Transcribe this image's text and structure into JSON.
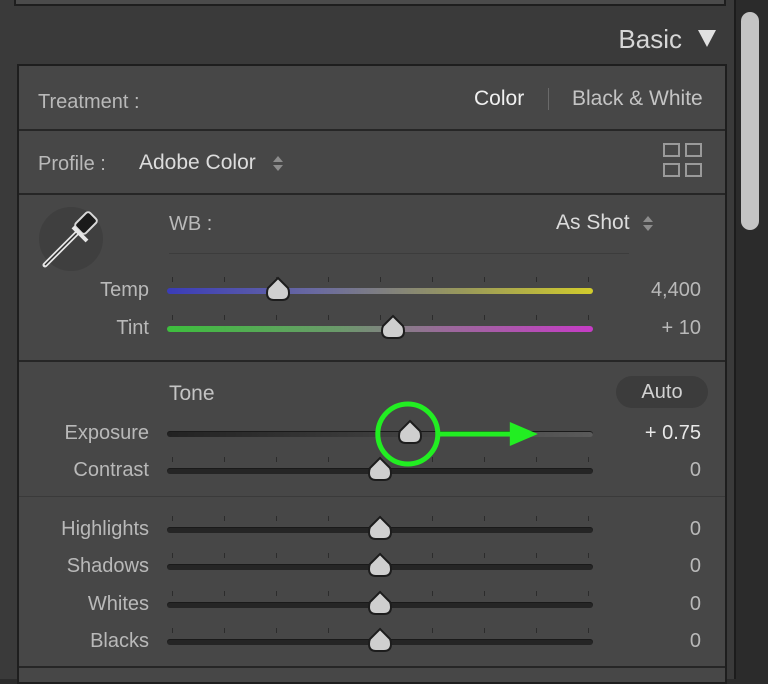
{
  "panel": {
    "title": "Basic"
  },
  "treatment": {
    "label": "Treatment :",
    "options": [
      "Color",
      "Black & White"
    ],
    "selected": "Color"
  },
  "profile": {
    "label": "Profile :",
    "value": "Adobe Color",
    "browser_icon": "grid-icon"
  },
  "wb": {
    "eyedropper_icon": "eyedropper-icon",
    "label": "WB :",
    "value": "As Shot"
  },
  "sliders_wb": [
    {
      "label": "Temp",
      "value": "4,400",
      "position": 0.26
    },
    {
      "label": "Tint",
      "value": "+ 10",
      "position": 0.53
    }
  ],
  "tone": {
    "label": "Tone",
    "auto_label": "Auto"
  },
  "sliders_tone": [
    {
      "label": "Exposure",
      "value": "+ 0.75",
      "position": 0.57
    },
    {
      "label": "Contrast",
      "value": "0",
      "position": 0.5
    }
  ],
  "sliders_presence": [
    {
      "label": "Highlights",
      "value": "0",
      "position": 0.5
    },
    {
      "label": "Shadows",
      "value": "0",
      "position": 0.5
    },
    {
      "label": "Whites",
      "value": "0",
      "position": 0.5
    },
    {
      "label": "Blacks",
      "value": "0",
      "position": 0.5
    }
  ],
  "annotation": {
    "color": "#22ee22"
  }
}
